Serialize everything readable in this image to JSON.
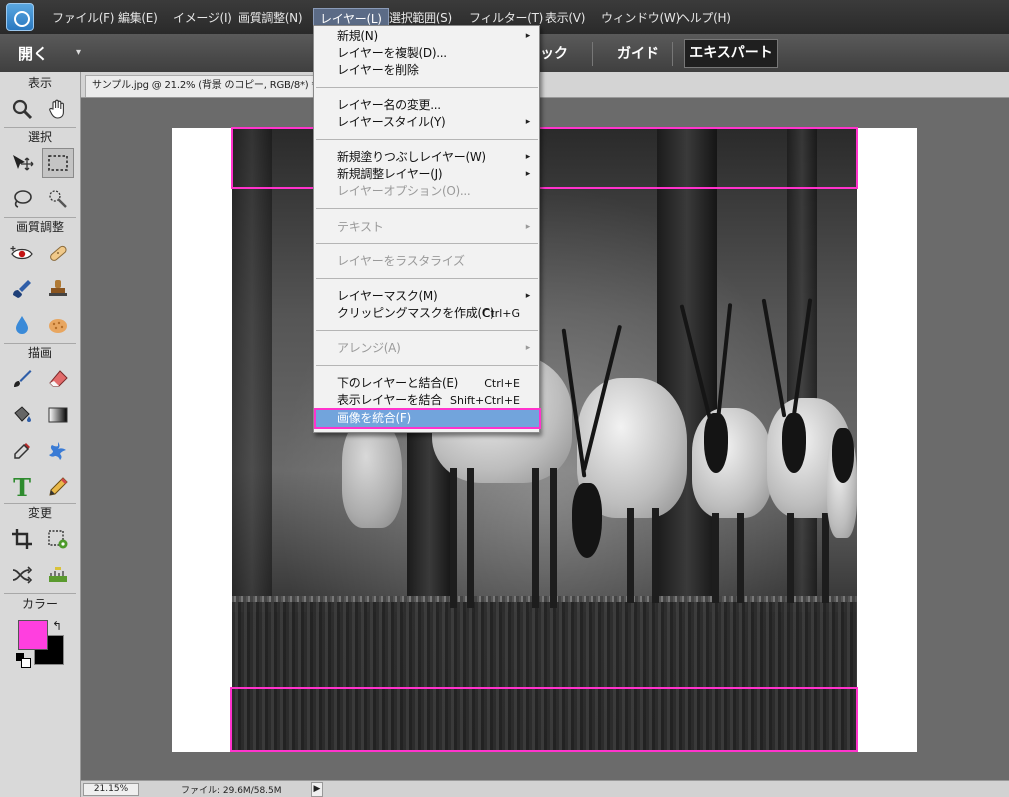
{
  "menubar": {
    "items": [
      "ファイル(F)",
      "編集(E)",
      "イメージ(I)",
      "画質調整(N)",
      "レイヤー(L)",
      "選択範囲(S)",
      "フィルター(T)",
      "表示(V)",
      "ウィンドウ(W)",
      "ヘルプ(H)"
    ],
    "active_index": 4
  },
  "optionsbar": {
    "open_label": "開く",
    "open_arrow": "▾",
    "modes": [
      "ックイック",
      "ガイド",
      "エキスパート"
    ],
    "quick_partial": "ック",
    "guide_label": "ガイド",
    "expert_label": "エキスパート",
    "active_mode": "エキスパート"
  },
  "toolpanel": {
    "sections": {
      "view": "表示",
      "select": "選択",
      "enhance": "画質調整",
      "draw": "描画",
      "modify": "変更",
      "color": "カラー"
    },
    "tools": {
      "zoom": "zoom-icon",
      "hand": "hand-icon",
      "move": "move-icon",
      "marquee": "rectangular-marquee-icon",
      "lasso": "lasso-icon",
      "quick_select": "quick-selection-icon",
      "red_eye": "red-eye-icon",
      "spot_healing": "spot-healing-icon",
      "smart_brush": "smart-brush-icon",
      "clone_stamp": "clone-stamp-icon",
      "blur": "blur-icon",
      "sponge": "sponge-icon",
      "brush": "brush-icon",
      "eraser": "eraser-icon",
      "paint_bucket": "paint-bucket-icon",
      "gradient": "gradient-icon",
      "eyedropper": "eyedropper-icon",
      "custom_shape": "custom-shape-icon",
      "type": "type-icon",
      "pencil": "pencil-icon",
      "crop": "crop-icon",
      "recompose": "recompose-icon",
      "content_aware_move": "content-aware-move-icon",
      "straighten": "straighten-icon"
    },
    "type_glyph": "T",
    "foreground_color": "#ff3fdf",
    "background_color": "#000000",
    "swap_glyph": "↰"
  },
  "document": {
    "tab_title": "サンプル.jpg @ 21.2% (背景 のコピー, RGB/8*) *"
  },
  "layer_menu": {
    "items": [
      {
        "label": "新規(N)",
        "submenu": true,
        "disabled": false
      },
      {
        "label": "レイヤーを複製(D)...",
        "submenu": false,
        "disabled": false
      },
      {
        "label": "レイヤーを削除",
        "submenu": false,
        "disabled": false
      },
      {
        "label": "レイヤー名の変更...",
        "submenu": false,
        "disabled": false
      },
      {
        "label": "レイヤースタイル(Y)",
        "submenu": true,
        "disabled": false
      },
      {
        "label": "新規塗りつぶしレイヤー(W)",
        "submenu": true,
        "disabled": false
      },
      {
        "label": "新規調整レイヤー(J)",
        "submenu": true,
        "disabled": false
      },
      {
        "label": "レイヤーオプション(O)...",
        "submenu": false,
        "disabled": true
      },
      {
        "label": "テキスト",
        "submenu": true,
        "disabled": true
      },
      {
        "label": "レイヤーをラスタライズ",
        "submenu": false,
        "disabled": true
      },
      {
        "label": "レイヤーマスク(M)",
        "submenu": true,
        "disabled": false
      },
      {
        "label": "クリッピングマスクを作成(C)",
        "shortcut": "Ctrl+G",
        "submenu": false,
        "disabled": false
      },
      {
        "label": "アレンジ(A)",
        "submenu": true,
        "disabled": true
      },
      {
        "label": "下のレイヤーと結合(E)",
        "shortcut": "Ctrl+E",
        "submenu": false,
        "disabled": false
      },
      {
        "label": "表示レイヤーを結合",
        "shortcut": "Shift+Ctrl+E",
        "submenu": false,
        "disabled": false
      },
      {
        "label": "画像を統合(F)",
        "submenu": false,
        "disabled": false,
        "highlighted": true
      }
    ],
    "submenu_glyph": "▸"
  },
  "statusbar": {
    "zoom": "21.15%",
    "file_info": "ファイル: 29.6M/58.5M",
    "arrow": "▶"
  },
  "selection_color": "#ff33cc"
}
